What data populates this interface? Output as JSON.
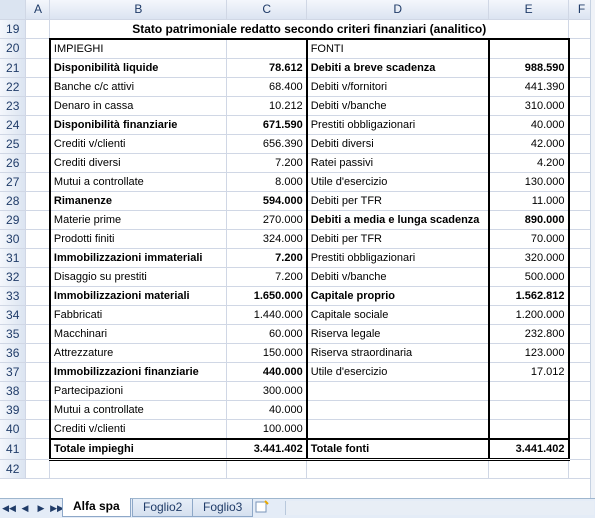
{
  "columns": [
    "A",
    "B",
    "C",
    "D",
    "E",
    "F"
  ],
  "rows": [
    "19",
    "20",
    "21",
    "22",
    "23",
    "24",
    "25",
    "26",
    "27",
    "28",
    "29",
    "30",
    "31",
    "32",
    "33",
    "34",
    "35",
    "36",
    "37",
    "38",
    "39",
    "40",
    "41",
    "42"
  ],
  "title": "Stato patrimoniale redatto secondo criteri finanziari (analitico)",
  "header": {
    "left": "IMPIEGHI",
    "right": "FONTI"
  },
  "table_rows": [
    {
      "l": "Disponibilità liquide",
      "lv": "78.612",
      "lb": true,
      "r": "Debiti a breve scadenza",
      "rv": "988.590",
      "rb": true
    },
    {
      "l": "Banche c/c attivi",
      "lv": "68.400",
      "lb": false,
      "r": "Debiti v/fornitori",
      "rv": "441.390",
      "rb": false
    },
    {
      "l": "Denaro in cassa",
      "lv": "10.212",
      "lb": false,
      "r": "Debiti v/banche",
      "rv": "310.000",
      "rb": false
    },
    {
      "l": "Disponibilità finanziarie",
      "lv": "671.590",
      "lb": true,
      "r": "Prestiti obbligazionari",
      "rv": "40.000",
      "rb": false
    },
    {
      "l": "Crediti v/clienti",
      "lv": "656.390",
      "lb": false,
      "r": "Debiti diversi",
      "rv": "42.000",
      "rb": false
    },
    {
      "l": "Crediti diversi",
      "lv": "7.200",
      "lb": false,
      "r": "Ratei passivi",
      "rv": "4.200",
      "rb": false
    },
    {
      "l": "Mutui a controllate",
      "lv": "8.000",
      "lb": false,
      "r": "Utile d'esercizio",
      "rv": "130.000",
      "rb": false
    },
    {
      "l": "Rimanenze",
      "lv": "594.000",
      "lb": true,
      "r": "Debiti per TFR",
      "rv": "11.000",
      "rb": false
    },
    {
      "l": "Materie prime",
      "lv": "270.000",
      "lb": false,
      "r": "Debiti a media e lunga scadenza",
      "rv": "890.000",
      "rb": true
    },
    {
      "l": "Prodotti finiti",
      "lv": "324.000",
      "lb": false,
      "r": "Debiti per TFR",
      "rv": "70.000",
      "rb": false
    },
    {
      "l": "Immobilizzazioni immateriali",
      "lv": "7.200",
      "lb": true,
      "r": "Prestiti obbligazionari",
      "rv": "320.000",
      "rb": false
    },
    {
      "l": "Disaggio su prestiti",
      "lv": "7.200",
      "lb": false,
      "r": "Debiti v/banche",
      "rv": "500.000",
      "rb": false
    },
    {
      "l": "Immobilizzazioni materiali",
      "lv": "1.650.000",
      "lb": true,
      "r": "Capitale proprio",
      "rv": "1.562.812",
      "rb": true
    },
    {
      "l": "Fabbricati",
      "lv": "1.440.000",
      "lb": false,
      "r": "Capitale sociale",
      "rv": "1.200.000",
      "rb": false
    },
    {
      "l": "Macchinari",
      "lv": "60.000",
      "lb": false,
      "r": "Riserva legale",
      "rv": "232.800",
      "rb": false
    },
    {
      "l": "Attrezzature",
      "lv": "150.000",
      "lb": false,
      "r": "Riserva straordinaria",
      "rv": "123.000",
      "rb": false
    },
    {
      "l": "Immobilizzazioni finanziarie",
      "lv": "440.000",
      "lb": true,
      "r": "Utile d'esercizio",
      "rv": "17.012",
      "rb": false
    },
    {
      "l": "Partecipazioni",
      "lv": "300.000",
      "lb": false,
      "r": "",
      "rv": "",
      "rb": false
    },
    {
      "l": "Mutui a controllate",
      "lv": "40.000",
      "lb": false,
      "r": "",
      "rv": "",
      "rb": false
    },
    {
      "l": "Crediti v/clienti",
      "lv": "100.000",
      "lb": false,
      "r": "",
      "rv": "",
      "rb": false
    }
  ],
  "totals": {
    "l": "Totale impieghi",
    "lv": "3.441.402",
    "r": "Totale fonti",
    "rv": "3.441.402"
  },
  "tabs": [
    "Alfa spa",
    "Foglio2",
    "Foglio3"
  ],
  "active_tab": "Alfa spa",
  "icons": {
    "nav_first": "first-sheet-icon",
    "nav_prev": "prev-sheet-icon",
    "nav_next": "next-sheet-icon",
    "nav_last": "last-sheet-icon",
    "new_sheet": "insert-sheet-icon"
  },
  "colors": {
    "header_bg": "#dbe4f1",
    "gridline": "#d0d7e5",
    "header_text": "#1f3b68"
  }
}
